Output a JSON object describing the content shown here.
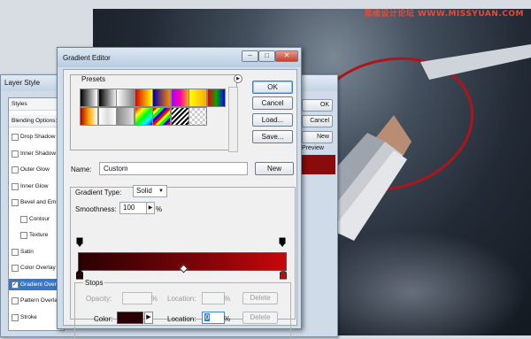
{
  "watermark": "思缘设计论坛 WWW.MISSYUAN.COM",
  "layer_style": {
    "title": "Layer Style",
    "items": [
      {
        "label": "Styles",
        "checkbox": false
      },
      {
        "label": "Blending Options:",
        "checkbox": false
      },
      {
        "label": "Drop Shadow",
        "checkbox": true,
        "checked": false
      },
      {
        "label": "Inner Shadow",
        "checkbox": true,
        "checked": false
      },
      {
        "label": "Outer Glow",
        "checkbox": true,
        "checked": false
      },
      {
        "label": "Inner Glow",
        "checkbox": true,
        "checked": false
      },
      {
        "label": "Bevel and Emboss",
        "checkbox": true,
        "checked": false
      },
      {
        "label": "Contour",
        "checkbox": true,
        "checked": false
      },
      {
        "label": "Texture",
        "checkbox": true,
        "checked": false
      },
      {
        "label": "Satin",
        "checkbox": true,
        "checked": false
      },
      {
        "label": "Color Overlay",
        "checkbox": true,
        "checked": false
      },
      {
        "label": "Gradient Overlay",
        "checkbox": true,
        "checked": true,
        "selected": true
      },
      {
        "label": "Pattern Overlay",
        "checkbox": true,
        "checked": false
      },
      {
        "label": "Stroke",
        "checkbox": true,
        "checked": false
      }
    ],
    "right_buttons": [
      "OK",
      "Cancel",
      "New Style...",
      "Preview"
    ],
    "preview_color": "#8a0b0b"
  },
  "gradient_editor": {
    "title": "Gradient Editor",
    "window_buttons": [
      "–",
      "□",
      "✕"
    ],
    "presets_label": "Presets",
    "buttons": {
      "ok": "OK",
      "cancel": "Cancel",
      "load": "Load...",
      "save": "Save...",
      "new": "New"
    },
    "name_label": "Name:",
    "name_value": "Custom",
    "gradient_type_label": "Gradient Type:",
    "gradient_type_value": "Solid",
    "smoothness_label": "Smoothness:",
    "smoothness_value": "100",
    "smoothness_unit": "%",
    "stops": {
      "label": "Stops",
      "opacity_label": "Opacity:",
      "opacity_unit": "%",
      "location_label": "Location:",
      "location_unit": "%",
      "color_label": "Color:",
      "color_value": "#2a0002",
      "color_location_label": "Location:",
      "color_location_value": "0",
      "color_location_unit": "%",
      "delete_label": "Delete"
    },
    "gradient_colors": {
      "start": "#2a0002",
      "end": "#c8080c"
    }
  }
}
